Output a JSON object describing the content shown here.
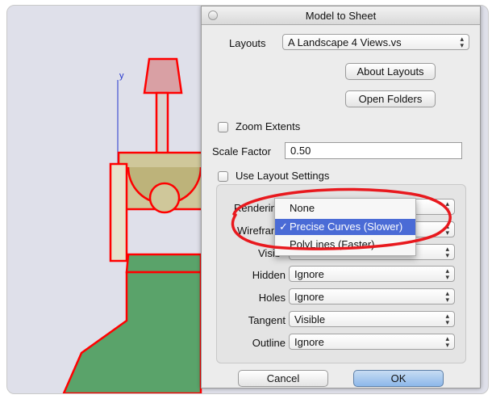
{
  "dialog": {
    "title": "Model to Sheet",
    "layouts_label": "Layouts",
    "layouts_value": "A Landscape 4 Views.vs",
    "about_layouts": "About Layouts",
    "open_folders": "Open Folders",
    "zoom_extents": "Zoom Extents",
    "scale_factor_label": "Scale Factor",
    "scale_factor_value": "0.50",
    "use_layout_settings": "Use Layout Settings",
    "rows": {
      "rendering_label": "Renderin",
      "wireframe_label": "Wirefran",
      "visible_label": "Visib",
      "hidden_label": "Hidden",
      "hidden_value": "Ignore",
      "holes_label": "Holes",
      "holes_value": "Ignore",
      "tangent_label": "Tangent",
      "tangent_value": "Visible",
      "outline_label": "Outline",
      "outline_value": "Ignore"
    },
    "menu": {
      "items": [
        "None",
        "Precise Curves (Slower)",
        "PolyLines (Faster)"
      ],
      "selected_mark": "✓"
    },
    "cancel": "Cancel",
    "ok": "OK"
  },
  "cad": {
    "axis_label": "y"
  },
  "colors": {
    "highlight_circle": "#e8191e",
    "model_outline": "#ff0000",
    "model_green": "#5aa36a",
    "selection": "#4a6bd6"
  }
}
